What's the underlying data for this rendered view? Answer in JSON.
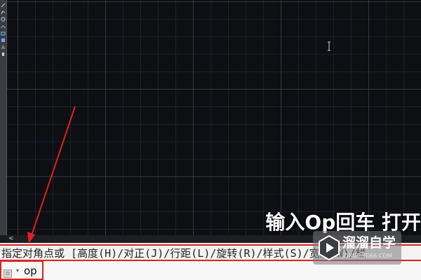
{
  "canvas": {
    "background_color": "#0d0f13",
    "grid_color": "#464e5c",
    "cursor_icon": "ibeam-cursor-icon"
  },
  "left_toolbar": {
    "tools": [
      "line-tool-icon",
      "polyline-tool-icon",
      "circle-tool-icon",
      "arc-tool-icon",
      "rectangle-tool-icon",
      "hatch-tool-icon",
      "text-tool-icon",
      "move-tool-icon"
    ]
  },
  "scroll": {
    "left_arrow": "<"
  },
  "caption": {
    "text": "输入Op回车 打开"
  },
  "command_line": {
    "prompt": "指定对角点或 [高度(H)/对正(J)/行距(L)/旋转(R)/样式(S)/宽度(W)/栏",
    "input_value": "op",
    "icon": "command-line-icon",
    "caret_icon": "dropdown-caret-icon"
  },
  "watermark": {
    "title": "溜溜自学",
    "subtitle": "ZIXUE.3D66.COM"
  },
  "annotations": {
    "highlight_color": "#e02020"
  }
}
